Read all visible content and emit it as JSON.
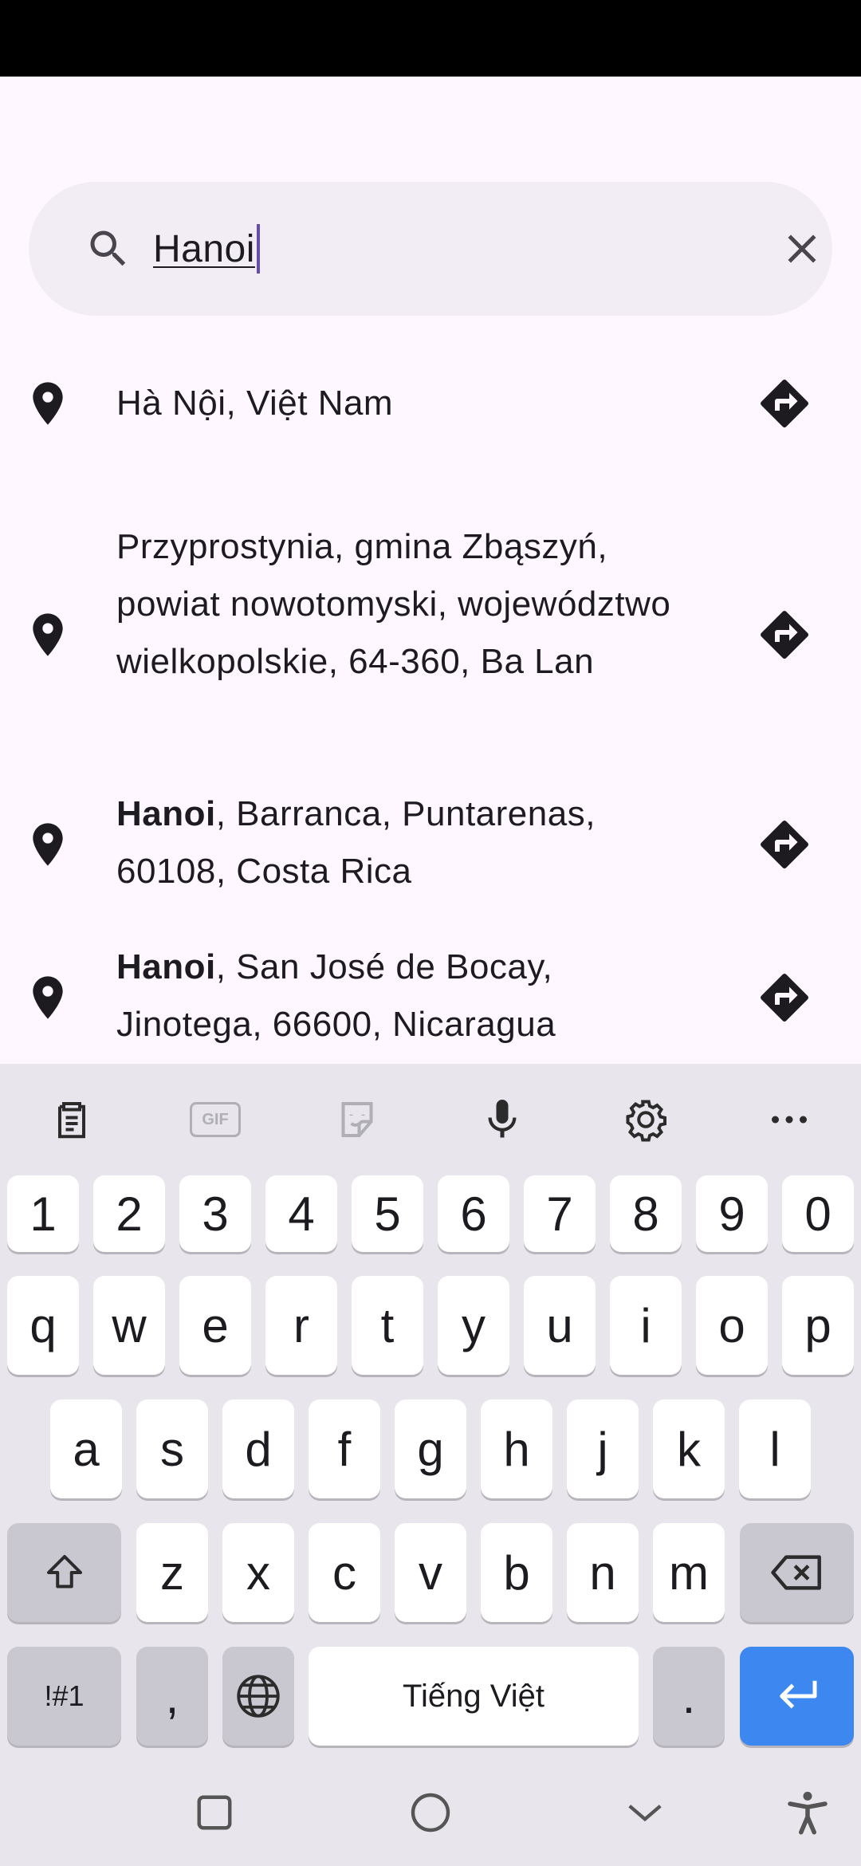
{
  "search": {
    "query": "Hanoi"
  },
  "results": [
    {
      "bold": "",
      "text": "Hà Nội, Việt Nam"
    },
    {
      "bold": "",
      "text": "Przyprostynia, gmina Zbąszyń, powiat nowotomyski, województwo wielkopolskie, 64-360, Ba Lan"
    },
    {
      "bold": "Hanoi",
      "text": ", Barranca, Puntarenas, 60108, Costa Rica"
    },
    {
      "bold": "Hanoi",
      "text": ", San José de Bocay, Jinotega, 66600, Nicaragua"
    }
  ],
  "keyboard": {
    "toolbar": [
      "clipboard-icon",
      "gif-icon",
      "sticker-icon",
      "microphone-icon",
      "settings-icon",
      "more-icon"
    ],
    "gif_label": "GIF",
    "number_row": [
      "1",
      "2",
      "3",
      "4",
      "5",
      "6",
      "7",
      "8",
      "9",
      "0"
    ],
    "row1": [
      "q",
      "w",
      "e",
      "r",
      "t",
      "y",
      "u",
      "i",
      "o",
      "p"
    ],
    "row2": [
      "a",
      "s",
      "d",
      "f",
      "g",
      "h",
      "j",
      "k",
      "l"
    ],
    "row3": [
      "z",
      "x",
      "c",
      "v",
      "b",
      "n",
      "m"
    ],
    "symbols_label": "!#1",
    "comma": ",",
    "space_label": "Tiếng Việt",
    "period": "."
  },
  "colors": {
    "accent": "#6750a4",
    "enter": "#3c88f0",
    "background": "#fef7ff"
  }
}
